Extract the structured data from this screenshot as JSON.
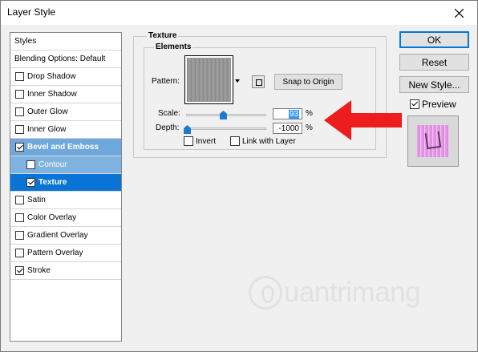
{
  "window": {
    "title": "Layer Style"
  },
  "styles_list": {
    "header": "Styles",
    "blending": "Blending Options: Default",
    "items": [
      {
        "label": "Drop Shadow",
        "checked": false
      },
      {
        "label": "Inner Shadow",
        "checked": false
      },
      {
        "label": "Outer Glow",
        "checked": false
      },
      {
        "label": "Inner Glow",
        "checked": false
      },
      {
        "label": "Bevel and Emboss",
        "checked": true
      },
      {
        "label": "Contour",
        "checked": false
      },
      {
        "label": "Texture",
        "checked": true
      },
      {
        "label": "Satin",
        "checked": false
      },
      {
        "label": "Color Overlay",
        "checked": false
      },
      {
        "label": "Gradient Overlay",
        "checked": false
      },
      {
        "label": "Pattern Overlay",
        "checked": false
      },
      {
        "label": "Stroke",
        "checked": true
      }
    ]
  },
  "texture_panel": {
    "group_title": "Texture",
    "elements_title": "Elements",
    "pattern_label": "Pattern:",
    "snap_button": "Snap to Origin",
    "scale_label": "Scale:",
    "scale_value": "93",
    "scale_unit": "%",
    "depth_label": "Depth:",
    "depth_value": "-1000",
    "depth_unit": "%",
    "invert_label": "Invert",
    "invert_checked": false,
    "link_label": "Link with Layer",
    "link_checked": false
  },
  "actions": {
    "ok": "OK",
    "reset": "Reset",
    "new_style": "New Style...",
    "preview_label": "Preview",
    "preview_checked": true
  },
  "watermark": {
    "text": "uantrimang"
  },
  "colors": {
    "selected_row": "#0a74d6",
    "parent_row": "#6fa8dc",
    "arrow": "#ee1c1c"
  }
}
